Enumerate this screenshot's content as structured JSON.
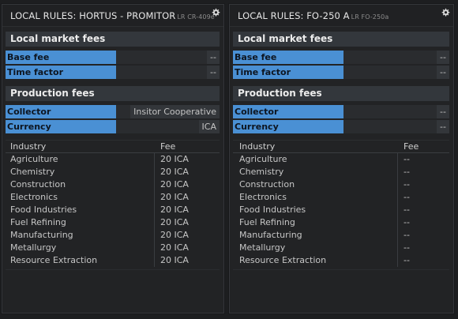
{
  "panels": [
    {
      "title": "LOCAL RULES: HORTUS - PROMITOR",
      "code": "LR CR-409e",
      "local_market_fees": {
        "heading": "Local market fees",
        "base_fee": {
          "label": "Base fee",
          "value": "--"
        },
        "time_factor": {
          "label": "Time factor",
          "value": "--"
        }
      },
      "production_fees": {
        "heading": "Production fees",
        "collector": {
          "label": "Collector",
          "value": "Insitor Cooperative"
        },
        "currency": {
          "label": "Currency",
          "value": "ICA"
        }
      },
      "table": {
        "headers": {
          "industry": "Industry",
          "fee": "Fee"
        },
        "rows": [
          {
            "industry": "Agriculture",
            "fee": "20 ICA"
          },
          {
            "industry": "Chemistry",
            "fee": "20 ICA"
          },
          {
            "industry": "Construction",
            "fee": "20 ICA"
          },
          {
            "industry": "Electronics",
            "fee": "20 ICA"
          },
          {
            "industry": "Food Industries",
            "fee": "20 ICA"
          },
          {
            "industry": "Fuel Refining",
            "fee": "20 ICA"
          },
          {
            "industry": "Manufacturing",
            "fee": "20 ICA"
          },
          {
            "industry": "Metallurgy",
            "fee": "20 ICA"
          },
          {
            "industry": "Resource Extraction",
            "fee": "20 ICA"
          }
        ]
      }
    },
    {
      "title": "LOCAL RULES: FO-250 A",
      "code": "LR FO-250a",
      "local_market_fees": {
        "heading": "Local market fees",
        "base_fee": {
          "label": "Base fee",
          "value": "--"
        },
        "time_factor": {
          "label": "Time factor",
          "value": "--"
        }
      },
      "production_fees": {
        "heading": "Production fees",
        "collector": {
          "label": "Collector",
          "value": "--"
        },
        "currency": {
          "label": "Currency",
          "value": "--"
        }
      },
      "table": {
        "headers": {
          "industry": "Industry",
          "fee": "Fee"
        },
        "rows": [
          {
            "industry": "Agriculture",
            "fee": "--"
          },
          {
            "industry": "Chemistry",
            "fee": "--"
          },
          {
            "industry": "Construction",
            "fee": "--"
          },
          {
            "industry": "Electronics",
            "fee": "--"
          },
          {
            "industry": "Food Industries",
            "fee": "--"
          },
          {
            "industry": "Fuel Refining",
            "fee": "--"
          },
          {
            "industry": "Manufacturing",
            "fee": "--"
          },
          {
            "industry": "Metallurgy",
            "fee": "--"
          },
          {
            "industry": "Resource Extraction",
            "fee": "--"
          }
        ]
      }
    }
  ],
  "colors": {
    "label_blue": "#4a90d4",
    "background": "#1d1e20",
    "panel": "#222325",
    "section_header": "#33373c"
  },
  "icons": {
    "settings": "gear-icon"
  }
}
